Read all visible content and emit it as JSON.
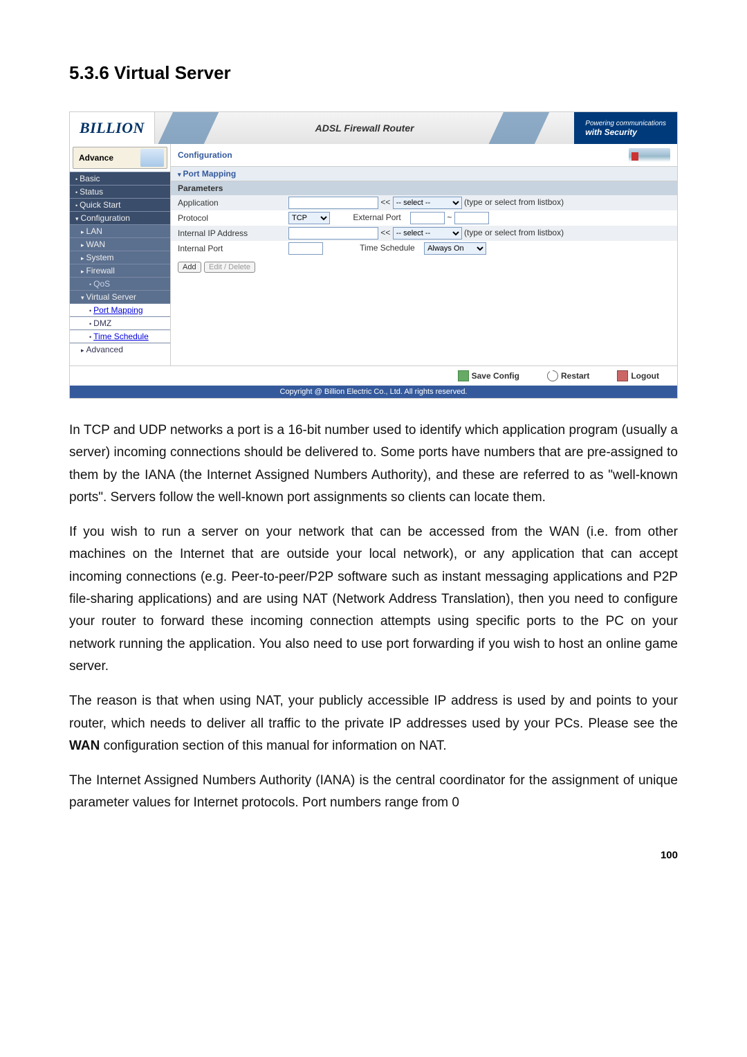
{
  "section_title": "5.3.6 Virtual Server",
  "router": {
    "logo": "BILLION",
    "title": "ADSL Firewall Router",
    "tagline_top": "Powering communications",
    "tagline_bottom": "with Security",
    "sidebar": {
      "tab": "Advance",
      "items": [
        {
          "label": "Basic",
          "cls": "header"
        },
        {
          "label": "Status",
          "cls": "header"
        },
        {
          "label": "Quick Start",
          "cls": "header"
        },
        {
          "label": "Configuration",
          "cls": "header",
          "tri": "▾"
        },
        {
          "label": "LAN",
          "cls": "sub1",
          "tri": "▸"
        },
        {
          "label": "WAN",
          "cls": "sub1",
          "tri": "▸"
        },
        {
          "label": "System",
          "cls": "sub1",
          "tri": "▸"
        },
        {
          "label": "Firewall",
          "cls": "sub1",
          "tri": "▸"
        },
        {
          "label": "QoS",
          "cls": "sub2"
        },
        {
          "label": "Virtual Server",
          "cls": "sub1",
          "tri": "▾"
        },
        {
          "label": "Port Mapping",
          "cls": "sub2 white highlight"
        },
        {
          "label": "DMZ",
          "cls": "sub2 white"
        },
        {
          "label": "Time Schedule",
          "cls": "sub2 white highlight"
        },
        {
          "label": "Advanced",
          "cls": "sub1 white",
          "tri": "▸"
        }
      ]
    },
    "main": {
      "heading": "Configuration",
      "panel_title": "Port Mapping",
      "panel_sub": "Parameters",
      "rows": {
        "application_label": "Application",
        "application_hint": "(type or select from listbox)",
        "application_select": "-- select --",
        "arrows": "<<",
        "protocol_label": "Protocol",
        "protocol_value": "TCP",
        "ext_port_label": "External Port",
        "ext_port_tilde": "~",
        "internal_ip_label": "Internal IP Address",
        "internal_ip_hint": "(type or select from listbox)",
        "internal_ip_select": "-- select --",
        "internal_port_label": "Internal Port",
        "time_label": "Time Schedule",
        "time_value": "Always On"
      },
      "buttons": {
        "add": "Add",
        "edit": "Edit / Delete"
      }
    },
    "footer": {
      "save": "Save Config",
      "restart": "Restart",
      "logout": "Logout"
    },
    "copyright": "Copyright @ Billion Electric Co., Ltd. All rights reserved."
  },
  "paragraphs": {
    "p1": "In TCP and UDP networks a port is a 16-bit number used to identify which application program (usually a server) incoming connections should be delivered to. Some ports have numbers that are pre-assigned to them by the IANA (the Internet Assigned Numbers Authority), and these are referred to as \"well-known ports\". Servers follow the well-known port assignments so clients can locate them.",
    "p2": "If you wish to run a server on your network that can be accessed from the WAN (i.e. from other machines on the Internet that are outside your local network), or any application that can accept incoming connections (e.g. Peer-to-peer/P2P software such as instant messaging applications and P2P file-sharing applications) and are using NAT (Network Address Translation), then you need to configure your router to forward these incoming connection attempts using specific ports to the PC on your network running the application. You also need to use port forwarding if you wish to host an online game server.",
    "p3a": "The reason is that when using NAT, your publicly accessible IP address is used by and points to your router, which needs to deliver all traffic to the private IP addresses used by your PCs. Please see the ",
    "p3b": "WAN",
    "p3c": " configuration section of this manual for information on NAT.",
    "p4": "The Internet Assigned Numbers Authority (IANA) is the central coordinator for the assignment of unique parameter values for Internet protocols. Port numbers range from 0"
  },
  "page_number": "100"
}
